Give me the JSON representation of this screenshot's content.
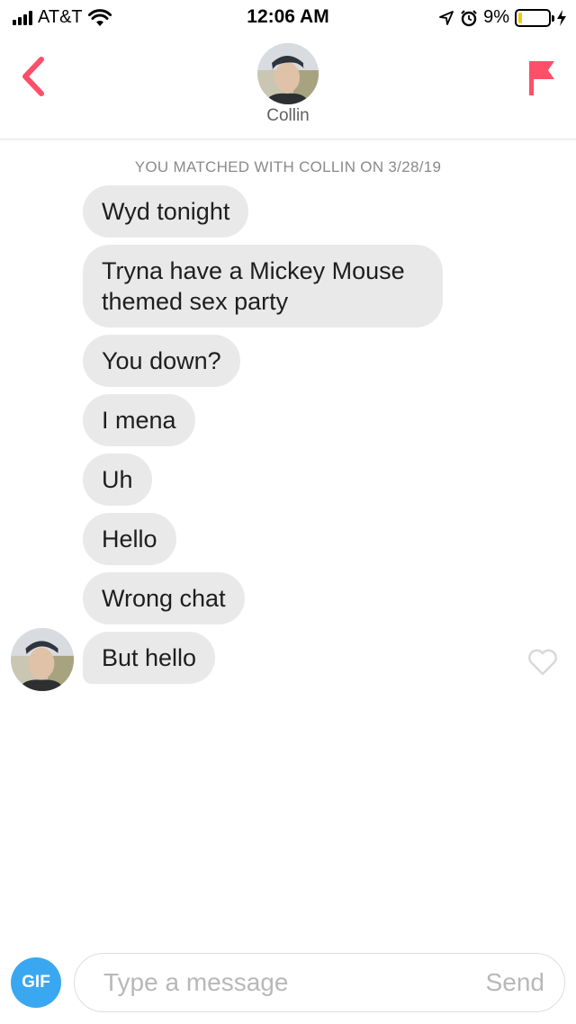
{
  "status_bar": {
    "carrier": "AT&T",
    "time": "12:06 AM",
    "battery_percent": "9%",
    "battery_level": 0.09,
    "icons": [
      "signal-bars-icon",
      "wifi-icon",
      "location-arrow-icon",
      "alarm-icon",
      "battery-icon",
      "charging-bolt-icon"
    ]
  },
  "header": {
    "back_icon": "chevron-left-icon",
    "report_icon": "flag-icon",
    "match_name": "Collin"
  },
  "chat": {
    "match_notice": "YOU MATCHED WITH COLLIN ON 3/28/19",
    "messages": [
      {
        "text": "Wyd tonight"
      },
      {
        "text": "Tryna have a Mickey Mouse themed sex party"
      },
      {
        "text": "You down?"
      },
      {
        "text": "I mena"
      },
      {
        "text": "Uh"
      },
      {
        "text": "Hello"
      },
      {
        "text": "Wrong chat"
      },
      {
        "text": "But hello"
      }
    ],
    "like_icon": "heart-outline-icon"
  },
  "composer": {
    "gif_label": "GIF",
    "placeholder": "Type a message",
    "value": "",
    "send_label": "Send"
  },
  "colors": {
    "accent": "#fd5068",
    "gif": "#3aa8f0",
    "bubble": "#e9e9e9",
    "battery_low": "#f2c811"
  }
}
